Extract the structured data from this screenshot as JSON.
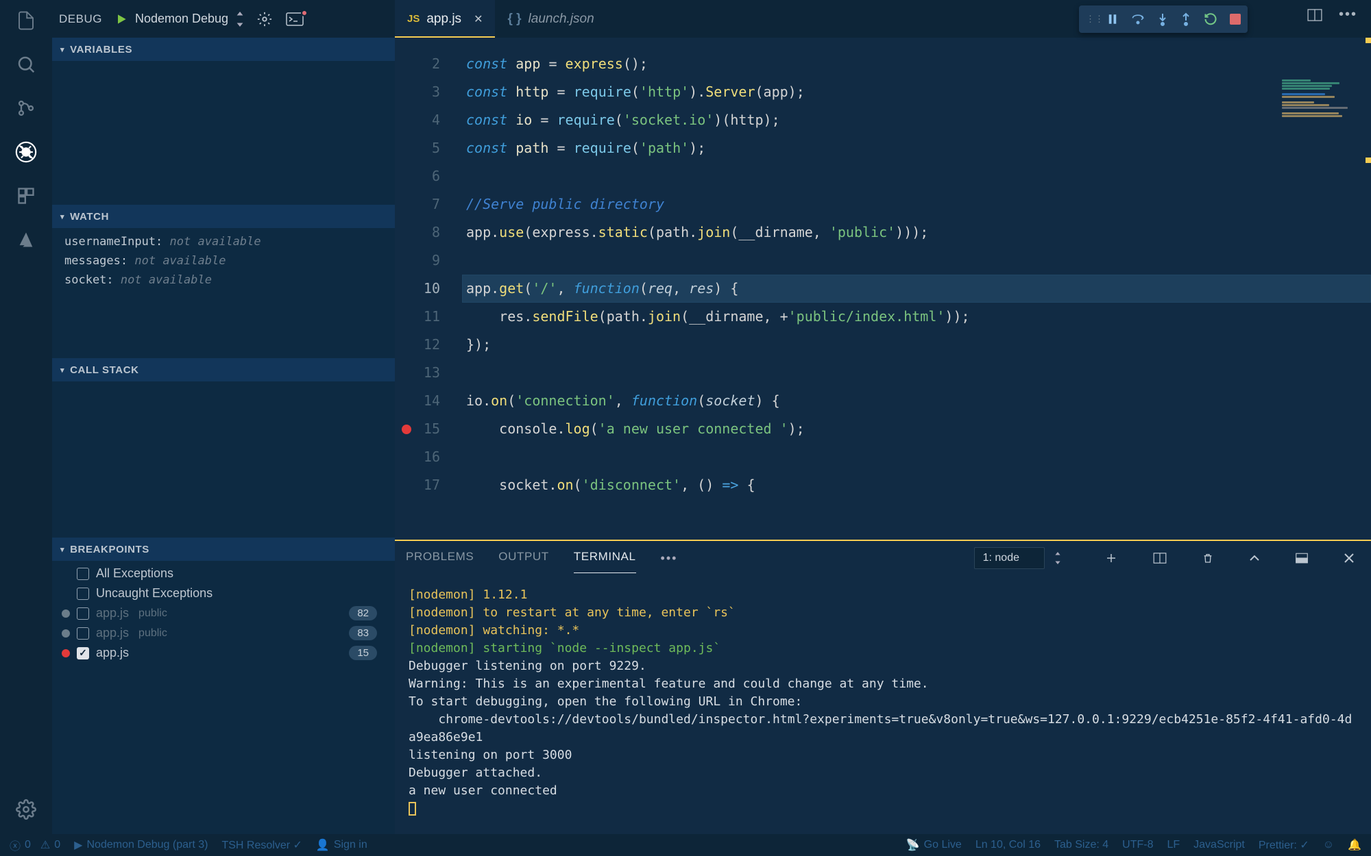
{
  "debug_header": {
    "title": "DEBUG",
    "config": "Nodemon Debug"
  },
  "sections": {
    "variables": "VARIABLES",
    "watch": "WATCH",
    "callstack": "CALL STACK",
    "breakpoints": "BREAKPOINTS"
  },
  "watch": [
    {
      "name": "usernameInput:",
      "status": "not available"
    },
    {
      "name": "messages:",
      "status": "not available"
    },
    {
      "name": "socket:",
      "status": "not available"
    }
  ],
  "breakpoints": {
    "all_ex": "All Exceptions",
    "uncaught": "Uncaught Exceptions",
    "items": [
      {
        "file": "app.js",
        "path": "public",
        "line": "82"
      },
      {
        "file": "app.js",
        "path": "public",
        "line": "83"
      },
      {
        "file": "app.js",
        "line": "15",
        "active": true
      }
    ]
  },
  "tabs": [
    {
      "name": "app.js",
      "kind": "js",
      "active": true
    },
    {
      "name": "launch.json",
      "kind": "json",
      "active": false,
      "italic": true
    }
  ],
  "panel_tabs": {
    "problems": "PROBLEMS",
    "output": "OUTPUT",
    "terminal": "TERMINAL",
    "more": "•••"
  },
  "terminal_select": "1: node",
  "terminal_lines": [
    {
      "tag": "[nodemon]",
      "text": " 1.12.1",
      "tagColor": "yel"
    },
    {
      "tag": "[nodemon]",
      "text": " to restart at any time, enter `rs`",
      "tagColor": "yel"
    },
    {
      "tag": "[nodemon]",
      "text": " watching: *.*",
      "tagColor": "yel"
    },
    {
      "tag": "[nodemon]",
      "text": " starting `node --inspect app.js`",
      "tagColor": "green"
    },
    {
      "text": "Debugger listening on port 9229."
    },
    {
      "text": "Warning: This is an experimental feature and could change at any time."
    },
    {
      "text": "To start debugging, open the following URL in Chrome:"
    },
    {
      "text": "    chrome-devtools://devtools/bundled/inspector.html?experiments=true&v8only=true&ws=127.0.0.1:9229/ecb4251e-85f2-4f41-afd0-4da9ea86e9e1"
    },
    {
      "text": "listening on port 3000"
    },
    {
      "text": "Debugger attached."
    },
    {
      "text": "a new user connected"
    }
  ],
  "editor": {
    "start": 2,
    "current": 10,
    "bp_lines": [
      15
    ],
    "lines": [
      {
        "n": 2,
        "html": "<span class='kw'>const</span> <span class='va'>app</span> <span class='op'>=</span> <span class='fn'>express</span>();"
      },
      {
        "n": 3,
        "html": "<span class='kw'>const</span> <span class='va'>http</span> <span class='op'>=</span> <span class='call'>require</span>(<span class='str'>'http'</span>).<span class='fn'>Server</span>(app);"
      },
      {
        "n": 4,
        "html": "<span class='kw'>const</span> <span class='va'>io</span> <span class='op'>=</span> <span class='call'>require</span>(<span class='str'>'socket.io'</span>)(http);"
      },
      {
        "n": 5,
        "html": "<span class='kw'>const</span> <span class='va'>path</span> <span class='op'>=</span> <span class='call'>require</span>(<span class='str'>'path'</span>);"
      },
      {
        "n": 6,
        "html": ""
      },
      {
        "n": 7,
        "html": "<span class='cmt'>//Serve public directory</span>"
      },
      {
        "n": 8,
        "html": "app.<span class='fn'>use</span>(express.<span class='fn'>static</span>(path.<span class='fn'>join</span>(__dirname, <span class='str'>'public'</span>)));"
      },
      {
        "n": 9,
        "html": ""
      },
      {
        "n": 10,
        "html": "app.<span class='fn'>get</span>(<span class='str'>'/'</span>, <span class='kw'>function</span>(<span class='par'>req</span>, <span class='par'>res</span>) {",
        "hl": true
      },
      {
        "n": 11,
        "html": "    res.<span class='fn'>sendFile</span>(path.<span class='fn'>join</span>(__dirname, <span class='op'>+</span><span class='str'>'public/index.html'</span>));"
      },
      {
        "n": 12,
        "html": "});"
      },
      {
        "n": 13,
        "html": ""
      },
      {
        "n": 14,
        "html": "io.<span class='fn'>on</span>(<span class='str'>'connection'</span>, <span class='kw'>function</span>(<span class='par'>socket</span>) {"
      },
      {
        "n": 15,
        "html": "    console.<span class='fn'>log</span>(<span class='str'>'a new user connected '</span>);"
      },
      {
        "n": 16,
        "html": ""
      },
      {
        "n": 17,
        "html": "    socket.<span class='fn'>on</span>(<span class='str'>'disconnect'</span>, () <span class='kw2'>=&gt;</span> {"
      }
    ]
  },
  "status": {
    "errors": "0",
    "warnings": "0",
    "debug": "Nodemon Debug (part 3)",
    "resolver": "TSH Resolver ✓",
    "signin": "Sign in",
    "golive": "Go Live",
    "lncol": "Ln 10, Col 16",
    "tabsize": "Tab Size: 4",
    "encoding": "UTF-8",
    "eol": "LF",
    "lang": "JavaScript",
    "prettier": "Prettier: ✓"
  }
}
